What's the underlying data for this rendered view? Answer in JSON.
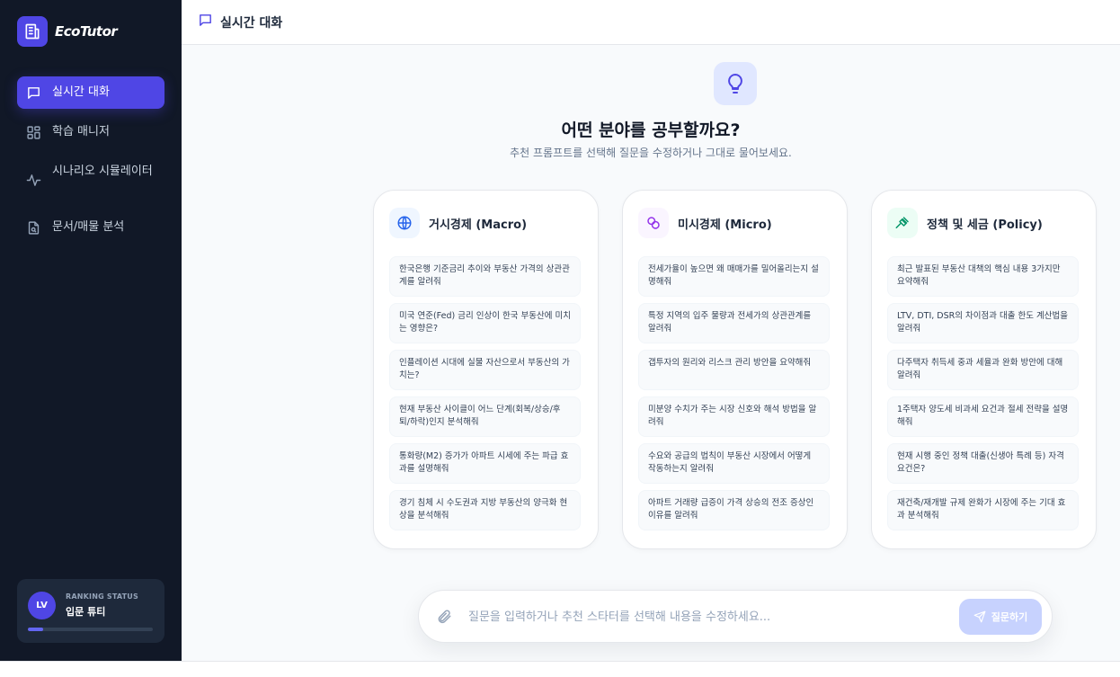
{
  "app": {
    "name": "EcoTutor",
    "logo_icon": "building-icon"
  },
  "sidebar": {
    "items": [
      {
        "label": "실시간 대화",
        "icon": "chat-icon",
        "active": true
      },
      {
        "label": "학습 매니저",
        "icon": "grid-icon",
        "active": false
      },
      {
        "label": "시나리오 시뮬레이터",
        "icon": "pulse-icon",
        "active": false
      },
      {
        "label": "문서/매물 분석",
        "icon": "document-search-icon",
        "active": false
      }
    ],
    "ranking": {
      "avatar_initials": "LV",
      "label": "RANKING STATUS",
      "value": "입문 튜티",
      "progress_percent": 12
    }
  },
  "header": {
    "title": "실시간 대화",
    "icon": "chat-icon"
  },
  "hero": {
    "icon": "lightbulb-icon",
    "title": "어떤 분야를 공부할까요?",
    "subtitle": "추천 프롬프트를 선택해 질문을 수정하거나 그대로 물어보세요."
  },
  "categories": [
    {
      "title": "거시경제 (Macro)",
      "icon": "globe-icon",
      "color": "#2563eb",
      "bg": "#eff6ff",
      "prompts": [
        "한국은행 기준금리 추이와 부동산 가격의 상관관계를 알려줘",
        "미국 연준(Fed) 금리 인상이 한국 부동산에 미치는 영향은?",
        "인플레이션 시대에 실물 자산으로서 부동산의 가치는?",
        "현재 부동산 사이클이 어느 단계(회복/상승/후퇴/하락)인지 분석해줘",
        "통화량(M2) 증가가 아파트 시세에 주는 파급 효과를 설명해줘",
        "경기 침체 시 수도권과 지방 부동산의 양극화 현상을 분석해줘"
      ]
    },
    {
      "title": "미시경제 (Micro)",
      "icon": "coins-icon",
      "color": "#9333ea",
      "bg": "#faf5ff",
      "prompts": [
        "전세가율이 높으면 왜 매매가를 밀어올리는지 설명해줘",
        "특정 지역의 입주 물량과 전세가의 상관관계를 알려줘",
        "갭투자의 원리와 리스크 관리 방안을 요약해줘",
        "미분양 수치가 주는 시장 신호와 해석 방법을 알려줘",
        "수요와 공급의 법칙이 부동산 시장에서 어떻게 작동하는지 알려줘",
        "아파트 거래량 급증이 가격 상승의 전조 증상인 이유를 알려줘"
      ]
    },
    {
      "title": "정책 및 세금 (Policy)",
      "icon": "gavel-icon",
      "color": "#059669",
      "bg": "#ecfdf5",
      "prompts": [
        "최근 발표된 부동산 대책의 핵심 내용 3가지만 요약해줘",
        "LTV, DTI, DSR의 차이점과 대출 한도 계산법을 알려줘",
        "다주택자 취득세 중과 세율과 완화 방안에 대해 알려줘",
        "1주택자 양도세 비과세 요건과 절세 전략을 설명해줘",
        "현재 시행 중인 정책 대출(신생아 특례 등) 자격 요건은?",
        "재건축/재개발 규제 완화가 시장에 주는 기대 효과 분석해줘"
      ]
    }
  ],
  "composer": {
    "placeholder": "질문을 입력하거나 추천 스타터를 선택해 내용을 수정하세요...",
    "value": "",
    "send_label": "질문하기",
    "attach_icon": "paperclip-icon",
    "send_icon": "send-icon"
  }
}
